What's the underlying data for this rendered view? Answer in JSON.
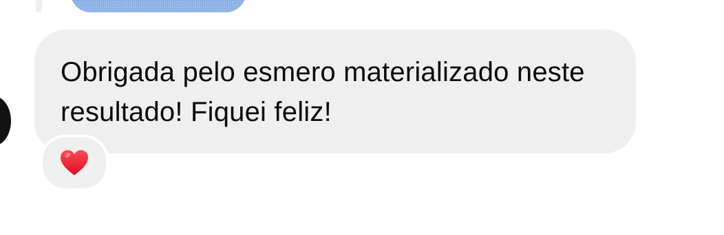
{
  "conversation": {
    "message": {
      "text": "Obrigada pelo esmero materializado neste resultado! Fiquei feliz!",
      "bubble_color": "#efefef",
      "text_color": "#0a0a0a"
    },
    "reaction": {
      "emoji": "heart-icon",
      "color": "#e8192c"
    },
    "previous_media_color": "#8fb6ea",
    "avatar_color": "#111214"
  }
}
